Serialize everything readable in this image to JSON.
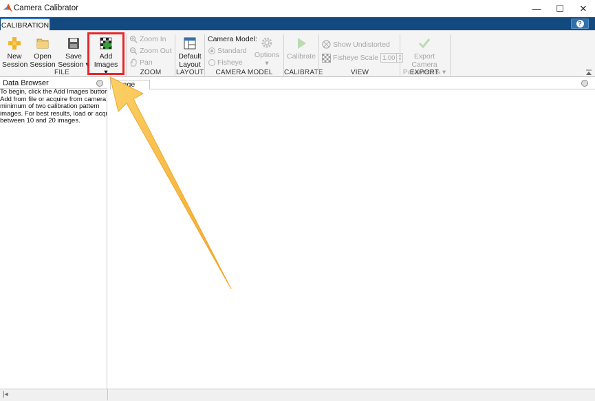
{
  "window": {
    "title": "Camera Calibrator",
    "minimize_glyph": "—",
    "maximize_glyph": "☐",
    "close_glyph": "✕"
  },
  "ribbon": {
    "tab_label": "CALIBRATION",
    "help_glyph": "?"
  },
  "file_section": {
    "label": "FILE",
    "new_session": {
      "line1": "New",
      "line2": "Session",
      "icon": "plus-icon"
    },
    "open_session": {
      "line1": "Open",
      "line2": "Session",
      "icon": "folder-icon"
    },
    "save_session": {
      "line1": "Save",
      "line2": "Session ▾",
      "icon": "floppy-disk-icon"
    },
    "add_images": {
      "line1": "Add",
      "line2": "Images ▾",
      "icon": "checkerboard-add-icon"
    }
  },
  "zoom_section": {
    "label": "ZOOM",
    "zoom_in": "Zoom In",
    "zoom_out": "Zoom Out",
    "pan": "Pan"
  },
  "layout_section": {
    "label": "LAYOUT",
    "default_layout": {
      "line1": "Default",
      "line2": "Layout",
      "icon": "layout-grid-icon"
    }
  },
  "camera_model_section": {
    "label": "CAMERA MODEL",
    "heading": "Camera Model:",
    "standard": "Standard",
    "fisheye": "Fisheye",
    "options": "Options",
    "selected": "Standard"
  },
  "calibrate_section": {
    "label": "CALIBRATE",
    "calibrate": "Calibrate"
  },
  "view_section": {
    "label": "VIEW",
    "show_undistorted": "Show Undistorted",
    "fisheye_scale": "Fisheye Scale",
    "fisheye_scale_value": "1.00"
  },
  "export_section": {
    "label": "EXPORT",
    "line1": "Export Camera",
    "line2": "Parameters ▾"
  },
  "data_browser": {
    "title": "Data Browser",
    "help_lines": [
      "To begin, click the Add Images button.",
      "Add from file or acquire from camera a",
      "minimum of two calibration pattern",
      "images. For best results, load or acquire",
      "between 10 and 20 images."
    ]
  },
  "image_panel": {
    "tab_label": "Image"
  },
  "status_bar": {
    "left_glyph": "|◂"
  },
  "colors": {
    "ribbon_blue": "#124a80",
    "highlight_red": "#e8262a",
    "arrow_yellow": "#f8b740",
    "disabled_gray": "#a6a6a6"
  }
}
